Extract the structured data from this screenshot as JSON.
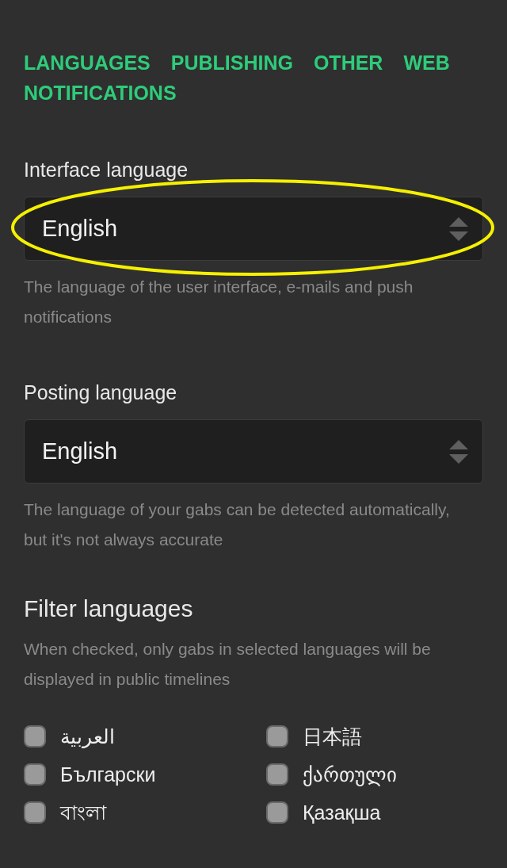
{
  "tabs": [
    {
      "label": "LANGUAGES"
    },
    {
      "label": "PUBLISHING"
    },
    {
      "label": "OTHER"
    },
    {
      "label": "WEB"
    },
    {
      "label": "NOTIFICATIONS"
    }
  ],
  "fields": [
    {
      "label": "Interface language",
      "value": "English",
      "hint": "The language of the user interface, e-mails and push notifications",
      "highlighted": true
    },
    {
      "label": "Posting language",
      "value": "English",
      "hint": "The language of your gabs can be detected automatically, but it's not always accurate",
      "highlighted": false
    }
  ],
  "filter": {
    "title": "Filter languages",
    "hint": "When checked, only gabs in selected languages will be displayed in public timelines",
    "languages": [
      {
        "label": "العربية",
        "checked": false
      },
      {
        "label": "日本語",
        "checked": false
      },
      {
        "label": "Български",
        "checked": false
      },
      {
        "label": "ქართული",
        "checked": false
      },
      {
        "label": "বাংলা",
        "checked": false
      },
      {
        "label": "Қазақша",
        "checked": false
      }
    ]
  }
}
